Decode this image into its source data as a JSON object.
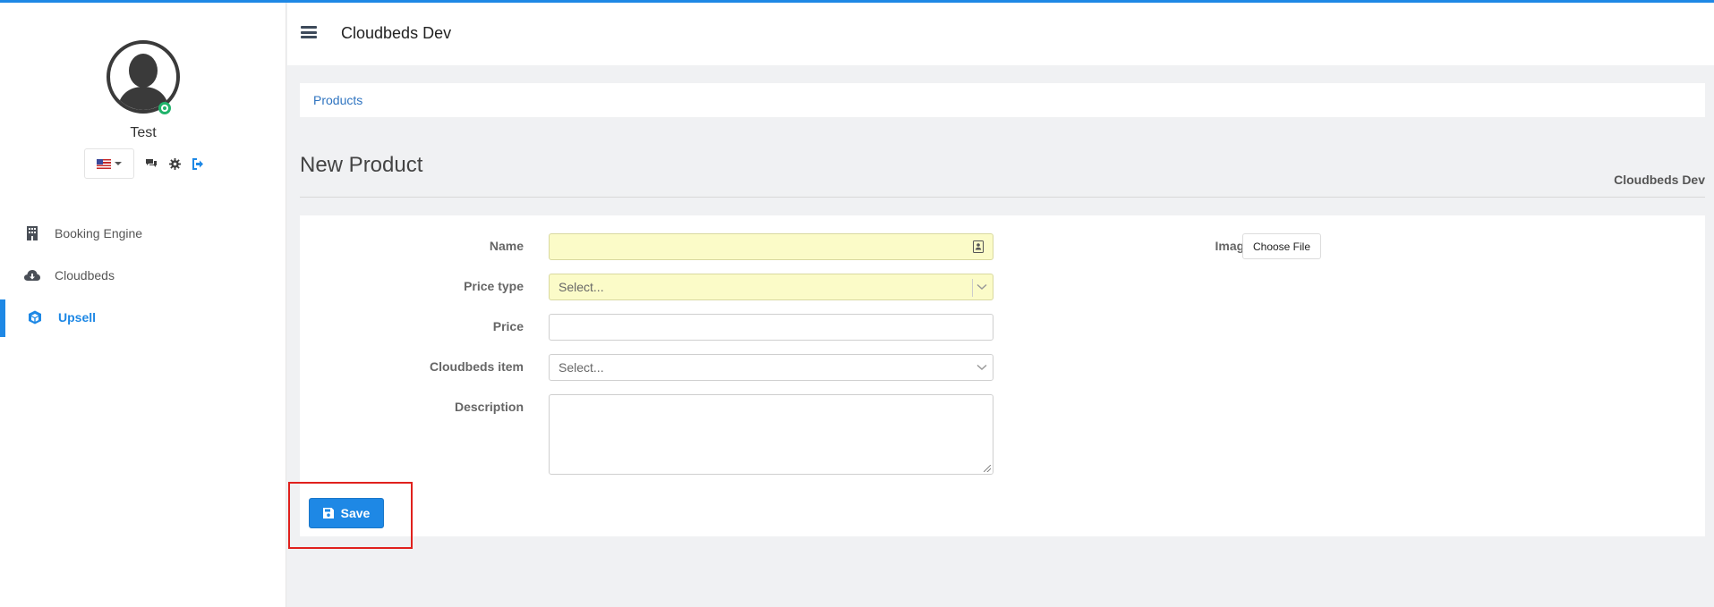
{
  "app": {
    "title": "Cloudbeds Dev",
    "accent_color": "#1e88e5"
  },
  "user": {
    "name": "Test",
    "status": "online",
    "language": "en-US"
  },
  "icons": {
    "menu": "hamburger-icon",
    "avatar": "user-silhouette-icon",
    "chat": "comments-icon",
    "settings": "gear-icon",
    "logout": "sign-out-icon",
    "booking": "building-icon",
    "cloud": "cloud-download-icon",
    "upsell": "cube-icon",
    "save": "floppy-disk-icon",
    "contact": "contact-card-icon",
    "dropdown": "chevron-down-icon"
  },
  "sidebar": {
    "items": [
      {
        "label": "Booking Engine",
        "active": false
      },
      {
        "label": "Cloudbeds",
        "active": false
      },
      {
        "label": "Upsell",
        "active": true
      }
    ]
  },
  "breadcrumb": {
    "items": [
      "Products"
    ]
  },
  "page": {
    "title": "New Product",
    "org": "Cloudbeds Dev"
  },
  "form": {
    "name": {
      "label": "Name",
      "value": ""
    },
    "price_type": {
      "label": "Price type",
      "placeholder": "Select..."
    },
    "price": {
      "label": "Price",
      "value": ""
    },
    "cloudbeds_item": {
      "label": "Cloudbeds item",
      "placeholder": "Select..."
    },
    "description": {
      "label": "Description",
      "value": ""
    },
    "image": {
      "label": "Image",
      "button": "Choose File"
    },
    "save_label": "Save"
  }
}
